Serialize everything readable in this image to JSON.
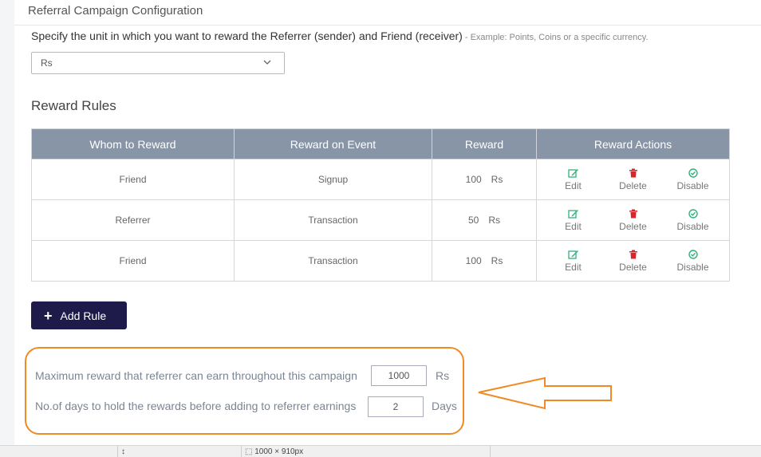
{
  "header": {
    "title": "Referral Campaign Configuration"
  },
  "unit": {
    "description": "Specify the unit in which you want to reward the Referrer (sender) and Friend (receiver)",
    "example": " - Example: Points, Coins or a specific currency.",
    "selected": "Rs"
  },
  "rules": {
    "title": "Reward Rules",
    "columns": [
      "Whom to Reward",
      "Reward on Event",
      "Reward",
      "Reward Actions"
    ],
    "rows": [
      {
        "whom": "Friend",
        "event": "Signup",
        "amount": "100",
        "unit": "Rs"
      },
      {
        "whom": "Referrer",
        "event": "Transaction",
        "amount": "50",
        "unit": "Rs"
      },
      {
        "whom": "Friend",
        "event": "Transaction",
        "amount": "100",
        "unit": "Rs"
      }
    ],
    "actions": {
      "edit": "Edit",
      "delete": "Delete",
      "disable": "Disable"
    },
    "add_label": "Add Rule"
  },
  "settings": {
    "max_reward_label": "Maximum reward that referrer can earn throughout this campaign",
    "max_reward_value": "1000",
    "max_reward_unit": "Rs",
    "hold_days_label": "No.of days to hold the rewards before adding to referrer earnings",
    "hold_days_value": "2",
    "hold_days_unit": "Days"
  },
  "status_bar": {
    "segment3": "1000 × 910px"
  },
  "colors": {
    "table_header": "#8895a7",
    "button": "#1e1b4b",
    "highlight": "#f08a24",
    "edit": "#2fb37a",
    "delete": "#d9262a",
    "disable": "#2fb37a"
  }
}
